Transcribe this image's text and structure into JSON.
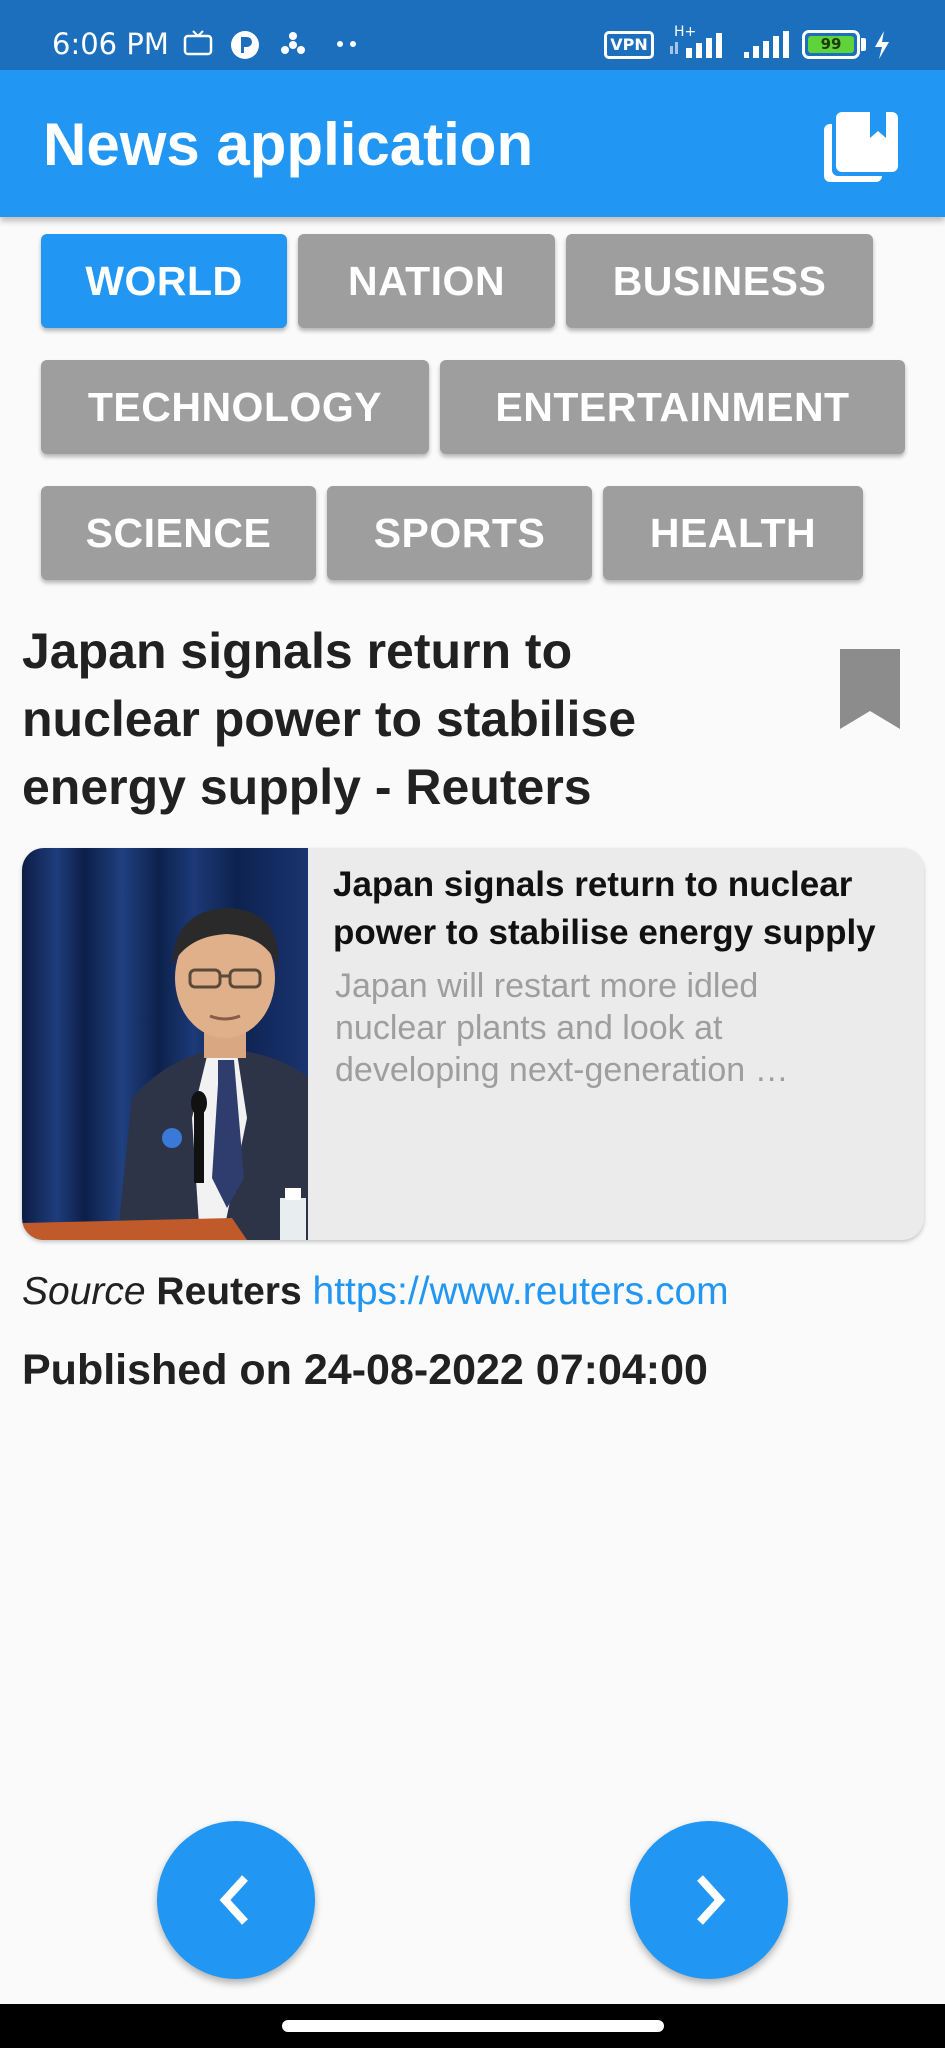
{
  "status_bar": {
    "time": "6:06 PM",
    "vpn": "VPN",
    "network_type": "H+",
    "battery": "99",
    "icons": [
      "tv-icon",
      "p-icon",
      "fan-icon",
      "more-dots-icon",
      "signal-icon",
      "signal-icon",
      "charging-icon"
    ]
  },
  "app_bar": {
    "title": "News application",
    "action_icon": "bookmarks-icon"
  },
  "categories": [
    {
      "label": "WORLD",
      "active": true
    },
    {
      "label": "NATION",
      "active": false
    },
    {
      "label": "BUSINESS",
      "active": false
    },
    {
      "label": "TECHNOLOGY",
      "active": false
    },
    {
      "label": "ENTERTAINMENT",
      "active": false
    },
    {
      "label": "SCIENCE",
      "active": false
    },
    {
      "label": "SPORTS",
      "active": false
    },
    {
      "label": "HEALTH",
      "active": false
    }
  ],
  "article": {
    "headline": "Japan signals return to nuclear power to stabilise energy supply - Reuters",
    "card": {
      "title": "Japan signals return to nuclear power to stabilise energy supply",
      "description": "Japan will restart more idled nuclear plants and look at developing next-generation …"
    },
    "source_label": "Source",
    "source_name": "Reuters",
    "source_url": "https://www.reuters.com",
    "published": "Published on 24-08-2022 07:04:00"
  },
  "navigation": {
    "previous_icon": "chevron-left-icon",
    "next_icon": "chevron-right-icon"
  },
  "colors": {
    "primary": "#2196f3",
    "status_bar": "#1c6fbd",
    "chip_inactive": "#9e9e9e",
    "link": "#2196f3"
  }
}
